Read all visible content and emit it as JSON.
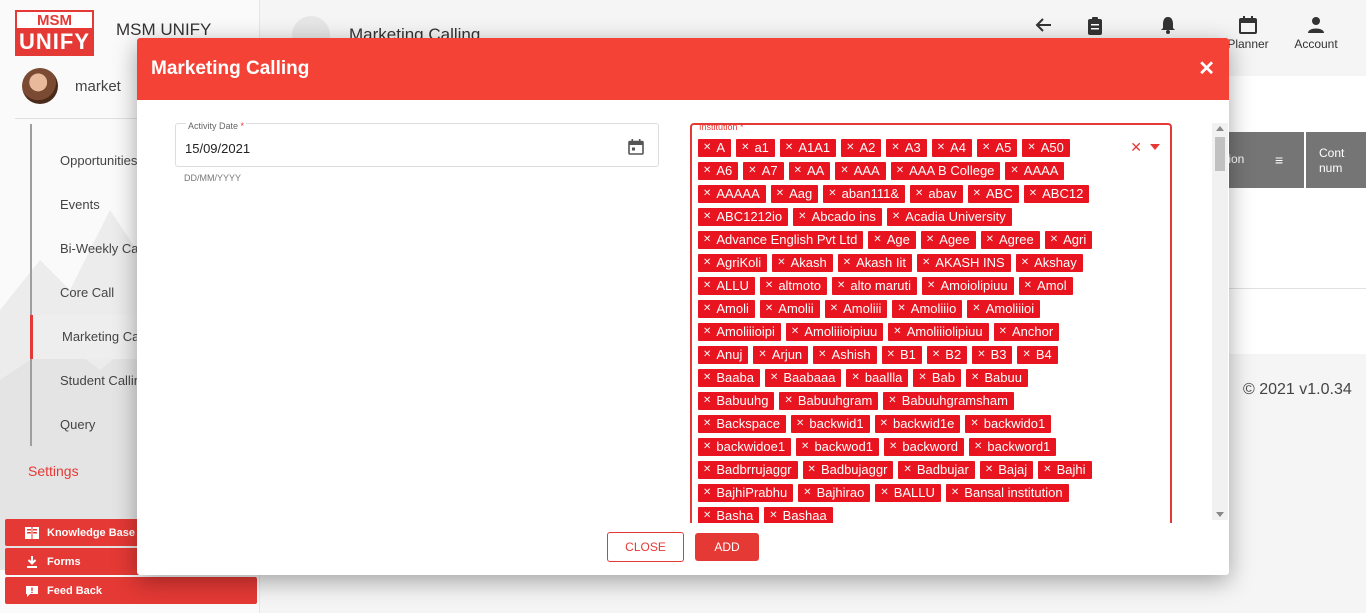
{
  "sidebar": {
    "logo_top": "MSM",
    "logo_bottom": "UNIFY",
    "app_name": "MSM UNIFY",
    "user_name": "market",
    "nav": [
      "Opportunities",
      "Events",
      "Bi-Weekly Cal",
      "Core Call",
      "Marketing Ca",
      "Student Callin",
      "Query"
    ],
    "active_nav": "Marketing Ca",
    "settings": "Settings",
    "buttons": [
      "Knowledge Base",
      "Forms",
      "Feed Back"
    ],
    "accent_color": "#e53935"
  },
  "header": {
    "title": "Marketing Calling",
    "icons": [
      {
        "name": "back-arrow-icon",
        "label": ""
      },
      {
        "name": "clipboard-icon",
        "label": ""
      },
      {
        "name": "bell-icon",
        "label": ""
      },
      {
        "name": "calendar-icon",
        "label": "Planner"
      },
      {
        "name": "account-icon",
        "label": "Account"
      }
    ]
  },
  "background": {
    "table_header": "tion",
    "table_header_2a": "Cont",
    "table_header_2b": "num",
    "version": "© 2021 v1.0.34"
  },
  "modal": {
    "title": "Marketing Calling",
    "close_symbol": "✕",
    "activity_date": {
      "label": "Activity Date",
      "required": "*",
      "value": "15/09/2021",
      "hint": "DD/MM/YYYY"
    },
    "institution": {
      "label": "Institution",
      "required": "*",
      "chips": [
        "A",
        "a1",
        "A1A1",
        "A2",
        "A3",
        "A4",
        "A5",
        "A50",
        "A6",
        "A7",
        "AA",
        "AAA",
        "AAA B College",
        "AAAA",
        "AAAAA",
        "Aag",
        "aban111&",
        "abav",
        "ABC",
        "ABC12",
        "ABC1212io",
        "Abcado ins",
        "Acadia University",
        "Advance English Pvt Ltd",
        "Age",
        "Agee",
        "Agree",
        "Agri",
        "AgriKoli",
        "Akash",
        "Akash Iit",
        "AKASH INS",
        "Akshay",
        "ALLU",
        "altmoto",
        "alto maruti",
        "Amoiolipiuu",
        "Amol",
        "Amoli",
        "Amolii",
        "Amoliii",
        "Amoliiio",
        "Amoliiioi",
        "Amoliiioipi",
        "Amoliiioipiuu",
        "Amoliiiolipiuu",
        "Anchor",
        "Anuj",
        "Arjun",
        "Ashish",
        "B1",
        "B2",
        "B3",
        "B4",
        "Baaba",
        "Baabaaa",
        "baallla",
        "Bab",
        "Babuu",
        "Babuuhg",
        "Babuuhgram",
        "Babuuhgramsham",
        "Backspace",
        "backwid1",
        "backwid1e",
        "backwido1",
        "backwidoe1",
        "backwod1",
        "backword",
        "backword1",
        "Badbrrujaggr",
        "Badbujaggr",
        "Badbujar",
        "Bajaj",
        "Bajhi",
        "BajhiPrabhu",
        "Bajhirao",
        "BALLU",
        "Bansal institution",
        "Basha",
        "Bashaa"
      ]
    },
    "close_button": "CLOSE",
    "add_button": "ADD"
  }
}
